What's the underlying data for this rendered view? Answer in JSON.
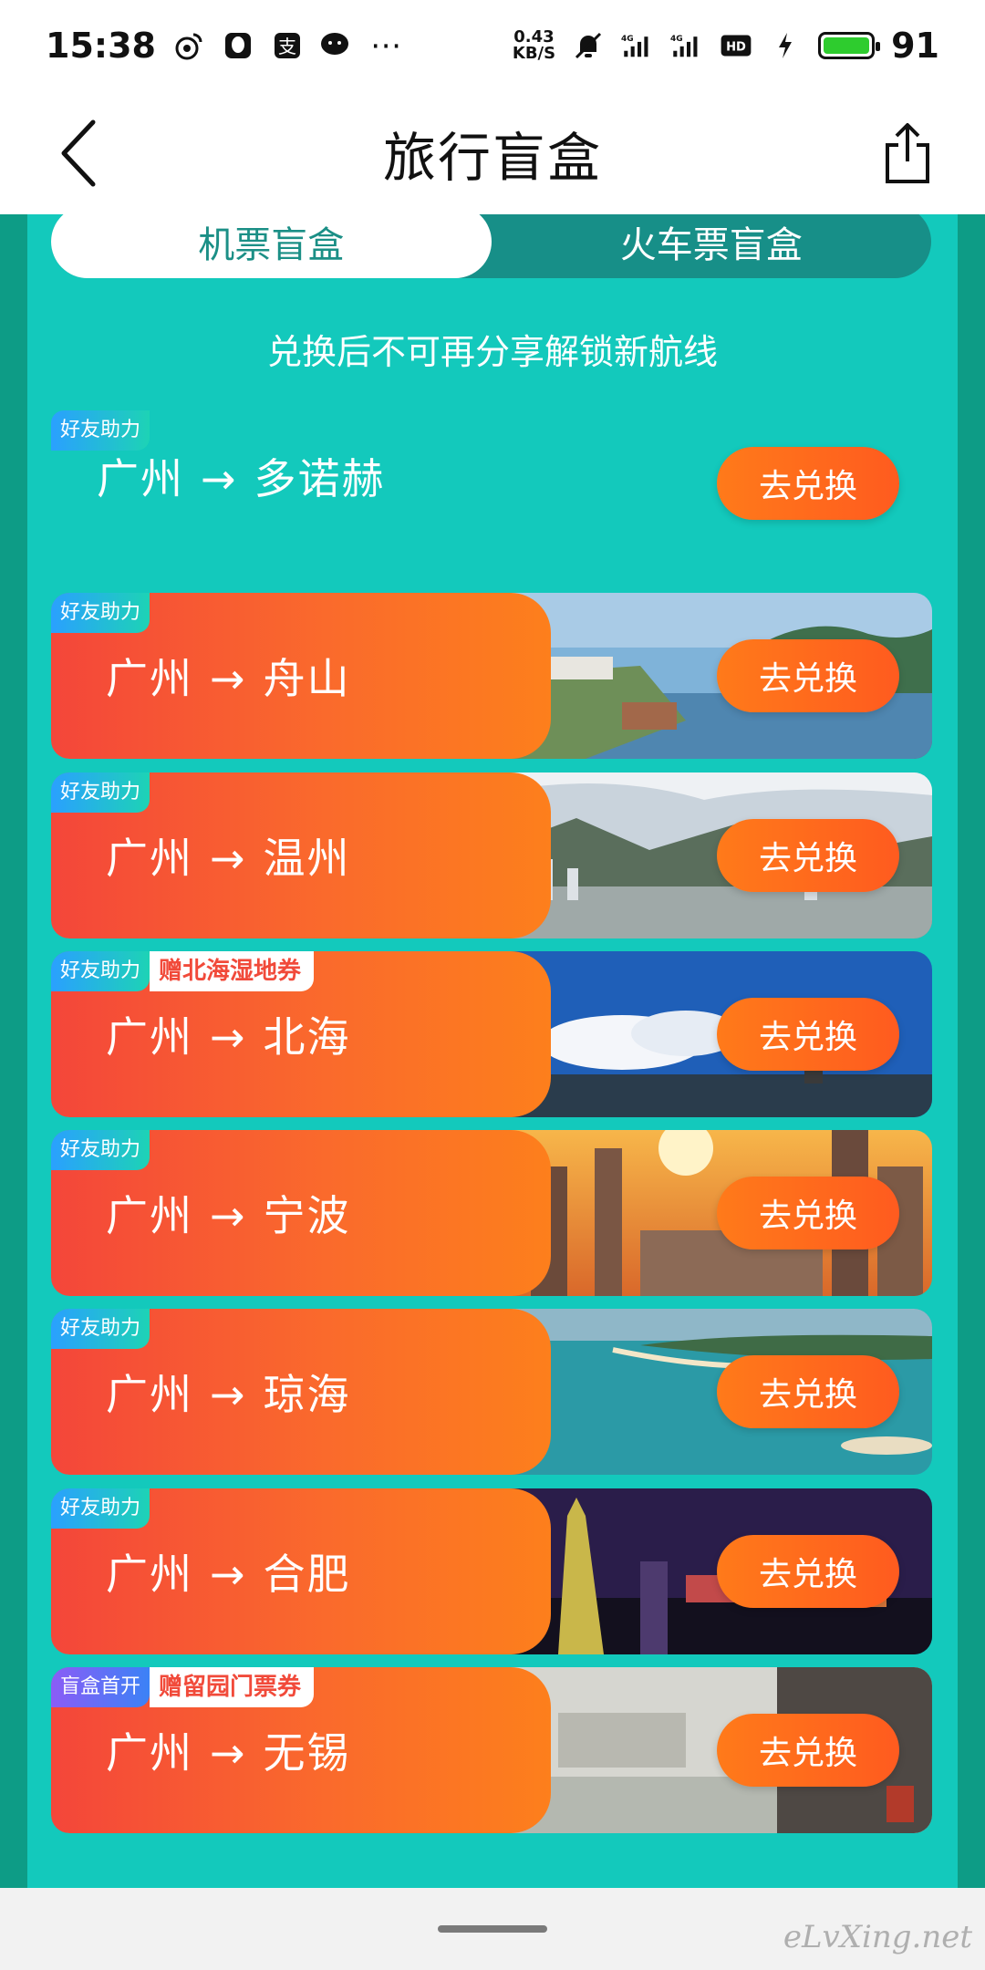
{
  "status_bar": {
    "time": "15:38",
    "net_speed_value": "0.43",
    "net_speed_unit": "KB/S",
    "battery_level": "91",
    "signal_label_1": "4G",
    "signal_label_2": "4G",
    "hd_label": "HD"
  },
  "header": {
    "title": "旅行盲盒"
  },
  "tabs": [
    {
      "label": "机票盲盒",
      "active": true
    },
    {
      "label": "火车票盲盒",
      "active": false
    }
  ],
  "notice": "兑换后不可再分享解锁新航线",
  "routes": [
    {
      "badge": "好友助力",
      "extra": "",
      "from": "广州",
      "arrow": "→",
      "to": "多诺赫",
      "button": "去兑换"
    },
    {
      "badge": "好友助力",
      "extra": "",
      "from": "广州",
      "arrow": "→",
      "to": "舟山",
      "button": "去兑换"
    },
    {
      "badge": "好友助力",
      "extra": "",
      "from": "广州",
      "arrow": "→",
      "to": "温州",
      "button": "去兑换"
    },
    {
      "badge": "好友助力",
      "extra": "赠北海湿地券",
      "from": "广州",
      "arrow": "→",
      "to": "北海",
      "button": "去兑换"
    },
    {
      "badge": "好友助力",
      "extra": "",
      "from": "广州",
      "arrow": "→",
      "to": "宁波",
      "button": "去兑换"
    },
    {
      "badge": "好友助力",
      "extra": "",
      "from": "广州",
      "arrow": "→",
      "to": "琼海",
      "button": "去兑换"
    },
    {
      "badge": "好友助力",
      "extra": "",
      "from": "广州",
      "arrow": "→",
      "to": "合肥",
      "button": "去兑换"
    },
    {
      "badge": "盲盒首开",
      "extra": "赠留园门票券",
      "from": "广州",
      "arrow": "→",
      "to": "无锡",
      "button": "去兑换"
    }
  ],
  "watermark": "eLvXing.net"
}
